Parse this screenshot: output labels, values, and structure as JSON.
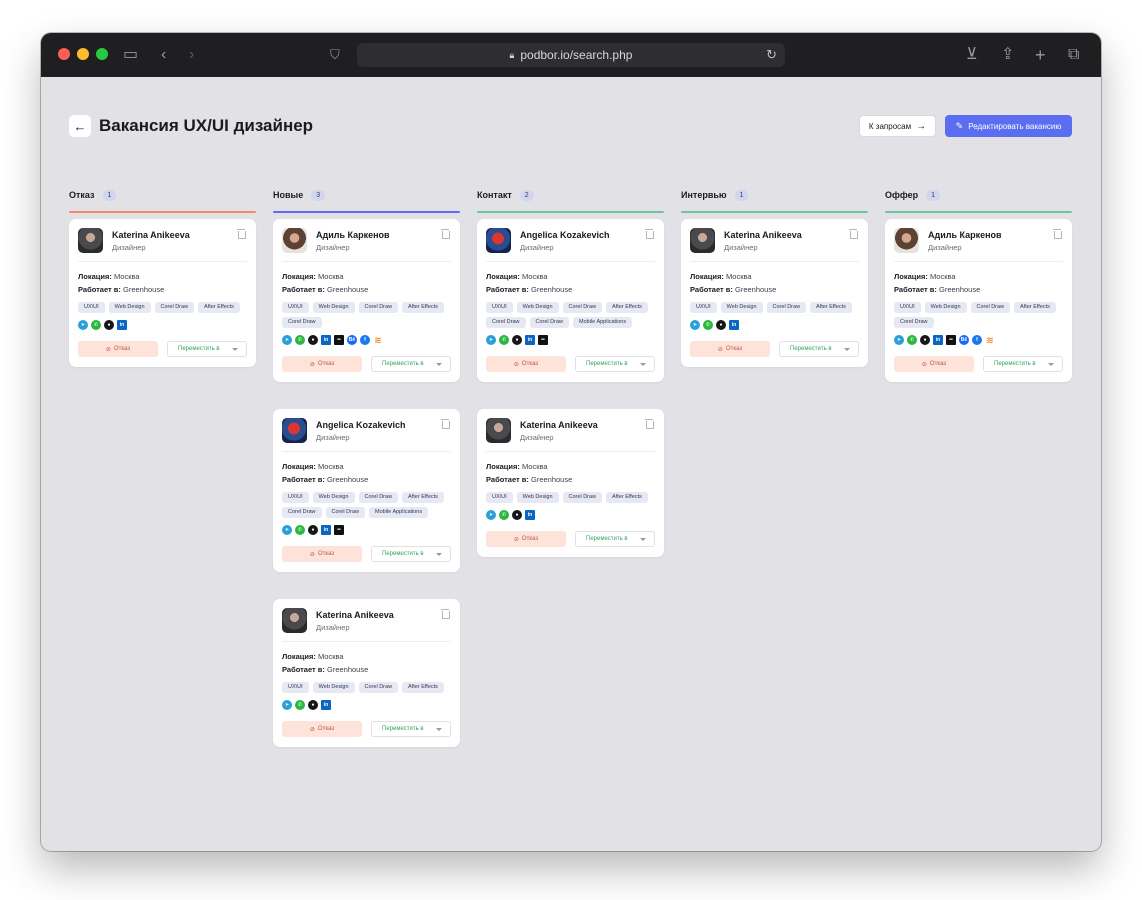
{
  "browser": {
    "url": "podbor.io/search.php"
  },
  "header": {
    "back_icon": "←",
    "title": "Вакансия UX/UI дизайнер",
    "requests_button": "К запросам",
    "requests_arrow": "→",
    "edit_button": "Редактировать вакансию"
  },
  "colors": {
    "reject": "#f08a6a",
    "new": "#5b6df0",
    "contact": "#6cc79b",
    "interview": "#6cc79b",
    "offer": "#6cc79b",
    "accent": "#5b6df0"
  },
  "labels": {
    "location": "Локация:",
    "works_at": "Работает в:",
    "reject": "Отказ",
    "move": "Переместить в"
  },
  "columns": [
    {
      "title": "Отказ",
      "count": "1",
      "cards": [
        {
          "name": "Katerina Anikeeva",
          "role": "Дизайнер",
          "location": "Москва",
          "company": "Greenhouse",
          "avatar": "dark",
          "tags": [
            "UX\\UI",
            "Web Design",
            "Corel Draw",
            "After Effects"
          ],
          "socials": [
            "telegram",
            "whatsapp",
            "github",
            "linkedin"
          ]
        }
      ]
    },
    {
      "title": "Новые",
      "count": "3",
      "cards": [
        {
          "name": "Адиль Каркенов",
          "role": "Дизайнер",
          "location": "Москва",
          "company": "Greenhouse",
          "avatar": "warm",
          "tags": [
            "UX\\UI",
            "Web Design",
            "Corel Draw",
            "After Effects",
            "Corel Draw"
          ],
          "socials": [
            "telegram",
            "whatsapp",
            "github",
            "linkedin",
            "flickr",
            "behance",
            "facebook",
            "stackoverflow"
          ]
        },
        {
          "name": "Angelica Kozakevich",
          "role": "Дизайнер",
          "location": "Москва",
          "company": "Greenhouse",
          "avatar": "red",
          "tags": [
            "UX\\UI",
            "Web Design",
            "Corel Draw",
            "After Effects",
            "Corel Draw",
            "Corel Draw",
            "Mobile Applications"
          ],
          "socials": [
            "telegram",
            "whatsapp",
            "github",
            "linkedin",
            "flickr"
          ]
        },
        {
          "name": "Katerina Anikeeva",
          "role": "Дизайнер",
          "location": "Москва",
          "company": "Greenhouse",
          "avatar": "dark",
          "tags": [
            "UX\\UI",
            "Web Design",
            "Corel Draw",
            "After Effects"
          ],
          "socials": [
            "telegram",
            "whatsapp",
            "github",
            "linkedin"
          ]
        }
      ]
    },
    {
      "title": "Контакт",
      "count": "2",
      "cards": [
        {
          "name": "Angelica Kozakevich",
          "role": "Дизайнер",
          "location": "Москва",
          "company": "Greenhouse",
          "avatar": "red",
          "tags": [
            "UX\\UI",
            "Web Design",
            "Corel Draw",
            "After Effects",
            "Corel Draw",
            "Corel Draw",
            "Mobile Applications"
          ],
          "socials": [
            "telegram",
            "whatsapp",
            "github",
            "linkedin",
            "flickr"
          ]
        },
        {
          "name": "Katerina Anikeeva",
          "role": "Дизайнер",
          "location": "Москва",
          "company": "Greenhouse",
          "avatar": "dark",
          "tags": [
            "UX\\UI",
            "Web Design",
            "Corel Draw",
            "After Effects"
          ],
          "socials": [
            "telegram",
            "whatsapp",
            "github",
            "linkedin"
          ]
        }
      ]
    },
    {
      "title": "Интервью",
      "count": "1",
      "cards": [
        {
          "name": "Katerina Anikeeva",
          "role": "Дизайнер",
          "location": "Москва",
          "company": "Greenhouse",
          "avatar": "dark",
          "tags": [
            "UX\\UI",
            "Web Design",
            "Corel Draw",
            "After Effects"
          ],
          "socials": [
            "telegram",
            "whatsapp",
            "github",
            "linkedin"
          ]
        }
      ]
    },
    {
      "title": "Оффер",
      "count": "1",
      "cards": [
        {
          "name": "Адиль Каркенов",
          "role": "Дизайнер",
          "location": "Москва",
          "company": "Greenhouse",
          "avatar": "warm",
          "tags": [
            "UX\\UI",
            "Web Design",
            "Corel Draw",
            "After Effects",
            "Corel Draw"
          ],
          "socials": [
            "telegram",
            "whatsapp",
            "github",
            "linkedin",
            "flickr",
            "behance",
            "facebook",
            "stackoverflow"
          ]
        }
      ]
    }
  ]
}
